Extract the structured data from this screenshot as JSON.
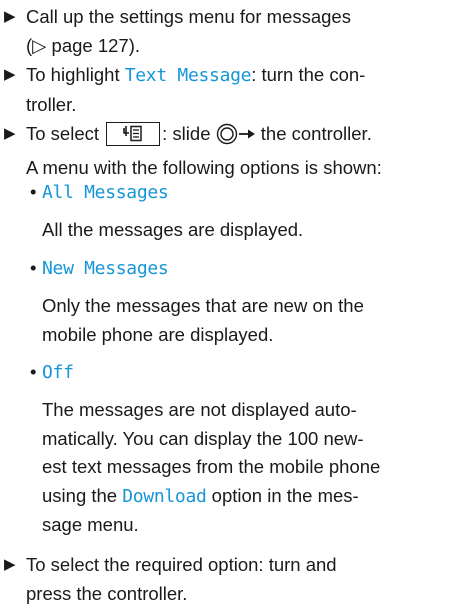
{
  "steps": {
    "s1": {
      "text": "Call up the settings menu for messages",
      "ref": "(▷ page 127)."
    },
    "s2": {
      "pre": "To highlight ",
      "highlight": "Text Message",
      "post": ": turn the con-",
      "line2": "troller."
    },
    "s3": {
      "pre": "To select ",
      "mid": ": slide ",
      "post": " the controller.",
      "line2": "A menu with the following options is shown:"
    },
    "s4": {
      "line1": "To select the required option: turn and",
      "line2": "press the controller."
    }
  },
  "options": [
    {
      "label": "All Messages",
      "desc": [
        "All the messages are displayed."
      ]
    },
    {
      "label": "New Messages",
      "desc": [
        "Only the messages that are new on the",
        "mobile phone are displayed."
      ]
    },
    {
      "label": "Off",
      "desc_parts": {
        "l1": "The messages are not displayed auto-",
        "l2": "matically. You can display the 100 new-",
        "l3": "est text messages from the mobile phone",
        "l4_pre": "using the ",
        "l4_hl": "Download",
        "l4_post": " option in the mes-",
        "l5": "sage menu."
      }
    }
  ],
  "icons": {
    "step_marker": "triangle-right-icon",
    "key": "menu-list-key-icon",
    "controller": "controller-slide-right-icon"
  },
  "colors": {
    "highlight": "#1696d8",
    "text": "#1a1a1a"
  }
}
